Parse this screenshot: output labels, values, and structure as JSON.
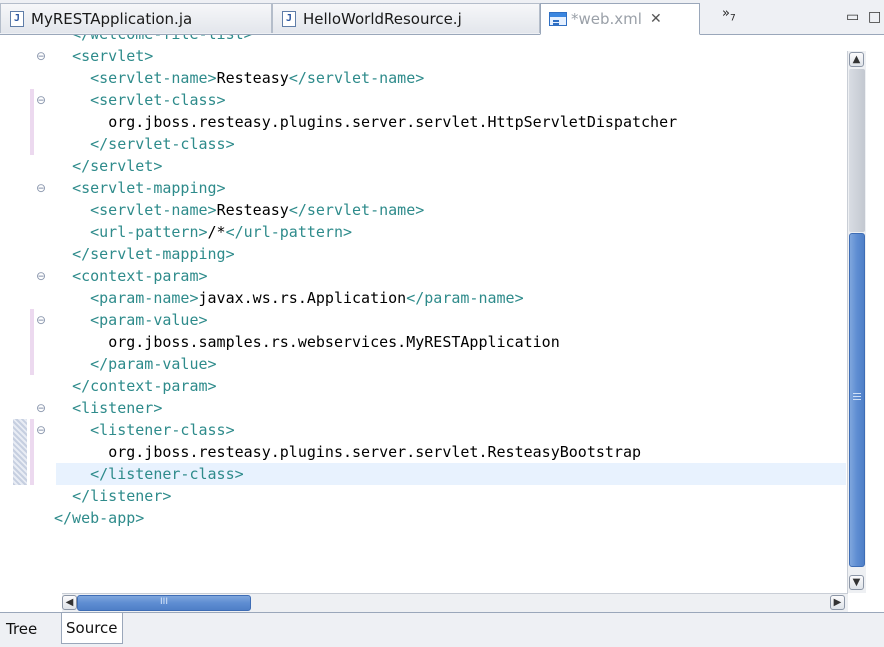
{
  "tabs": [
    {
      "label": "MyRESTApplication.ja",
      "icon": "java-file-icon",
      "active": false
    },
    {
      "label": "HelloWorldResource.j",
      "icon": "java-file-icon",
      "active": false
    },
    {
      "label": "*web.xml",
      "icon": "xml-file-icon",
      "active": true
    }
  ],
  "tab_close_glyph": "✕",
  "overflow": {
    "label": "»",
    "count": "7"
  },
  "window_controls": {
    "minimize": "▭",
    "maximize": "□"
  },
  "java_icon_glyph": "J",
  "code_lines": [
    {
      "indent": "  ",
      "parts": [
        {
          "t": "t",
          "v": "</welcome-file-list>"
        }
      ]
    },
    {
      "indent": "  ",
      "parts": [
        {
          "t": "t",
          "v": "<servlet>"
        }
      ]
    },
    {
      "indent": "    ",
      "parts": [
        {
          "t": "t",
          "v": "<servlet-name>"
        },
        {
          "t": "p",
          "v": "Resteasy"
        },
        {
          "t": "t",
          "v": "</servlet-name>"
        }
      ]
    },
    {
      "indent": "    ",
      "parts": [
        {
          "t": "t",
          "v": "<servlet-class>"
        }
      ]
    },
    {
      "indent": "      ",
      "parts": [
        {
          "t": "p",
          "v": "org.jboss.resteasy.plugins.server.servlet.HttpServletDispatcher"
        }
      ]
    },
    {
      "indent": "    ",
      "parts": [
        {
          "t": "t",
          "v": "</servlet-class>"
        }
      ]
    },
    {
      "indent": "  ",
      "parts": [
        {
          "t": "t",
          "v": "</servlet>"
        }
      ]
    },
    {
      "indent": "  ",
      "parts": [
        {
          "t": "t",
          "v": "<servlet-mapping>"
        }
      ]
    },
    {
      "indent": "    ",
      "parts": [
        {
          "t": "t",
          "v": "<servlet-name>"
        },
        {
          "t": "p",
          "v": "Resteasy"
        },
        {
          "t": "t",
          "v": "</servlet-name>"
        }
      ]
    },
    {
      "indent": "    ",
      "parts": [
        {
          "t": "t",
          "v": "<url-pattern>"
        },
        {
          "t": "p",
          "v": "/*"
        },
        {
          "t": "t",
          "v": "</url-pattern>"
        }
      ]
    },
    {
      "indent": "  ",
      "parts": [
        {
          "t": "t",
          "v": "</servlet-mapping>"
        }
      ]
    },
    {
      "indent": "  ",
      "parts": [
        {
          "t": "t",
          "v": "<context-param>"
        }
      ]
    },
    {
      "indent": "    ",
      "parts": [
        {
          "t": "t",
          "v": "<param-name>"
        },
        {
          "t": "p",
          "v": "javax.ws.rs.Application"
        },
        {
          "t": "t",
          "v": "</param-name>"
        }
      ]
    },
    {
      "indent": "    ",
      "parts": [
        {
          "t": "t",
          "v": "<param-value>"
        }
      ]
    },
    {
      "indent": "      ",
      "parts": [
        {
          "t": "p",
          "v": "org.jboss.samples.rs.webservices.MyRESTApplication"
        }
      ]
    },
    {
      "indent": "    ",
      "parts": [
        {
          "t": "t",
          "v": "</param-value>"
        }
      ]
    },
    {
      "indent": "  ",
      "parts": [
        {
          "t": "t",
          "v": "</context-param>"
        }
      ]
    },
    {
      "indent": "  ",
      "parts": [
        {
          "t": "t",
          "v": "<listener>"
        }
      ]
    },
    {
      "indent": "    ",
      "parts": [
        {
          "t": "t",
          "v": "<listener-class>"
        }
      ]
    },
    {
      "indent": "      ",
      "parts": [
        {
          "t": "p",
          "v": "org.jboss.resteasy.plugins.server.servlet.ResteasyBootstrap"
        }
      ]
    },
    {
      "indent": "    ",
      "parts": [
        {
          "t": "t",
          "v": "</listener-class>"
        }
      ]
    },
    {
      "indent": "  ",
      "parts": [
        {
          "t": "t",
          "v": "</listener>"
        }
      ]
    },
    {
      "indent": "",
      "parts": [
        {
          "t": "t",
          "v": "</web-app>"
        }
      ]
    }
  ],
  "current_line": 20,
  "fold_lines": [
    1,
    3,
    7,
    11,
    13,
    17,
    18
  ],
  "fold_glyph": "⊖",
  "scrollbar": {
    "up": "▲",
    "down": "▼",
    "left": "◀",
    "right": "▶",
    "thumb_grip": "III"
  },
  "bottom_tabs": [
    {
      "label": "Tree",
      "active": false
    },
    {
      "label": "Source",
      "active": true
    }
  ],
  "colors": {
    "tag": "#2e8b8b",
    "text": "#000000",
    "current_line": "#e8f2fe",
    "scroll_thumb": "#5e8dd2"
  }
}
